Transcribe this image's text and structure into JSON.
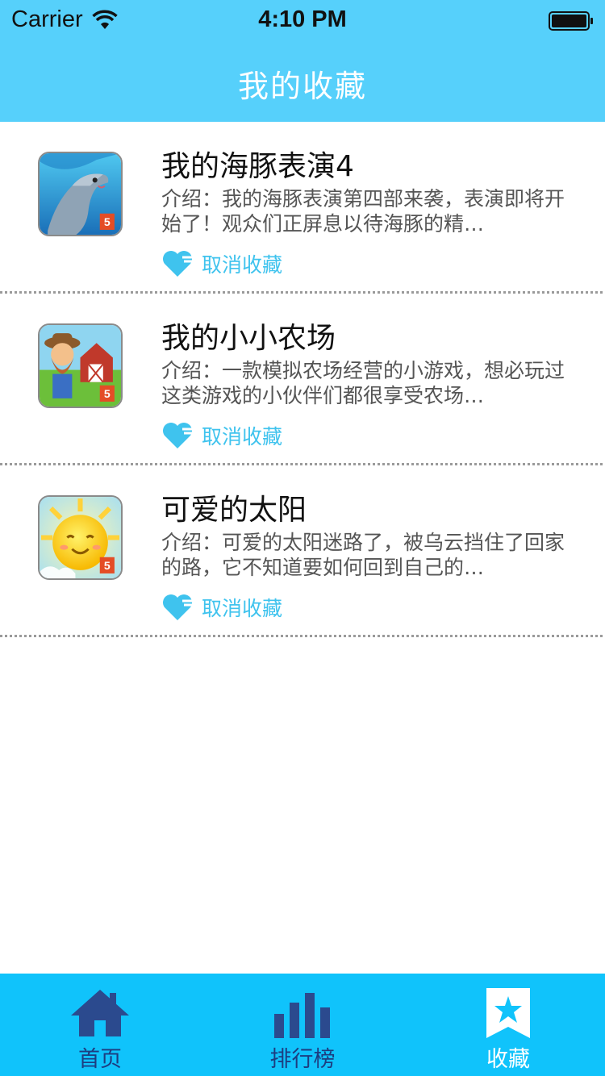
{
  "status_bar": {
    "carrier": "Carrier",
    "time": "4:10 PM",
    "icons": [
      "wifi-icon",
      "battery-icon"
    ]
  },
  "nav": {
    "title": "我的收藏"
  },
  "colors": {
    "header_bg": "#56d0fb",
    "tabbar_bg": "#10c3fb",
    "accent": "#3fc3ee",
    "tab_inactive": "#1d3d80",
    "tab_active": "#ffffff"
  },
  "favorites": [
    {
      "icon": "dolphin-game-icon",
      "title": "我的海豚表演4",
      "description": "介绍：我的海豚表演第四部来袭，表演即将开始了！观众们正屏息以待海豚的精…",
      "action_label": "取消收藏"
    },
    {
      "icon": "farm-game-icon",
      "title": "我的小小农场",
      "description": "介绍：一款模拟农场经营的小游戏，想必玩过这类游戏的小伙伴们都很享受农场…",
      "action_label": "取消收藏"
    },
    {
      "icon": "sun-game-icon",
      "title": "可爱的太阳",
      "description": "介绍：可爱的太阳迷路了，被乌云挡住了回家的路，它不知道要如何回到自己的…",
      "action_label": "取消收藏"
    }
  ],
  "tabbar": {
    "tabs": [
      {
        "label": "首页",
        "icon": "home-icon",
        "active": false
      },
      {
        "label": "排行榜",
        "icon": "bar-chart-icon",
        "active": false
      },
      {
        "label": "收藏",
        "icon": "star-bookmark-icon",
        "active": true
      }
    ]
  }
}
